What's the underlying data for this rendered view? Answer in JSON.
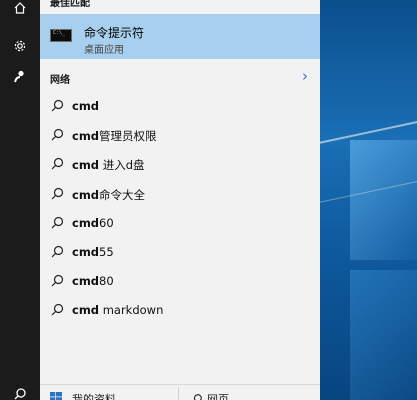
{
  "best_match": {
    "section_label": "最佳匹配",
    "app_title": "命令提示符",
    "app_subtitle": "桌面应用",
    "icon": "cmd-prompt-icon",
    "icon_glyph": "C:\\_"
  },
  "web": {
    "section_label": "网络",
    "chevron": "›"
  },
  "suggestions": [
    {
      "bold": "cmd",
      "rest": ""
    },
    {
      "bold": "cmd",
      "rest": "管理员权限"
    },
    {
      "bold": "cmd",
      "rest": " 进入d盘"
    },
    {
      "bold": "cmd",
      "rest": "命令大全"
    },
    {
      "bold": "cmd",
      "rest": "60"
    },
    {
      "bold": "cmd",
      "rest": "55"
    },
    {
      "bold": "cmd",
      "rest": "80"
    },
    {
      "bold": "cmd",
      "rest": " markdown"
    }
  ],
  "bottom_tabs": {
    "mine_label": "我的资料",
    "web_label": "网页"
  },
  "rail": {
    "home_icon": "home-icon",
    "settings_icon": "gear-icon",
    "user_icon": "user-icon",
    "search_icon": "search-icon"
  },
  "colors": {
    "selection": "#a9cfee",
    "accent": "#2a72c3",
    "rail": "#1b1b1b",
    "panel": "#f2f2f2"
  }
}
